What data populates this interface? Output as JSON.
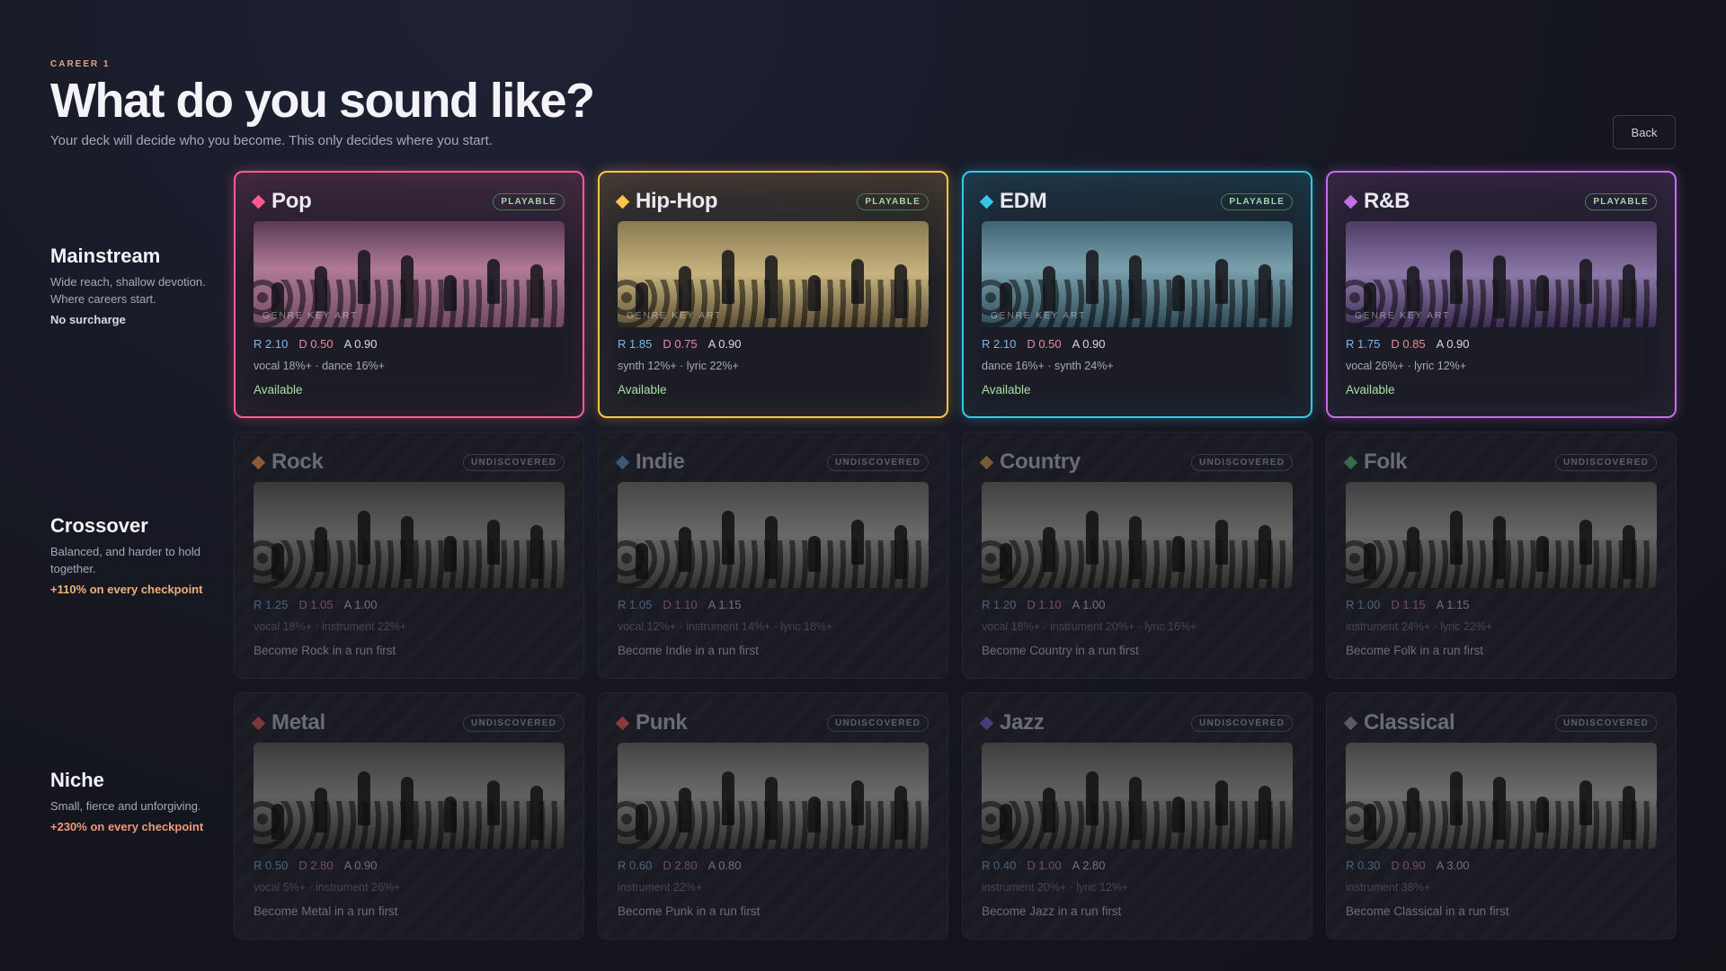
{
  "header": {
    "eyebrow": "CAREER 1",
    "title": "What do you sound like?",
    "subtitle": "Your deck will decide who you become. This only decides where you start.",
    "back_label": "Back"
  },
  "tiers": [
    {
      "name": "Mainstream",
      "desc": "Wide reach, shallow devotion. Where careers start.",
      "cost": "No surcharge",
      "cost_color": "#d8d9e2"
    },
    {
      "name": "Crossover",
      "desc": "Balanced, and harder to hold together.",
      "cost": "+110% on every checkpoint",
      "cost_color": "#f0b07a"
    },
    {
      "name": "Niche",
      "desc": "Small, fierce and unforgiving.",
      "cost": "+230% on every checkpoint",
      "cost_color": "#f09a7a"
    }
  ],
  "colors": {
    "r_stat": "#7fb8e8",
    "d_stat": "#e88a9a",
    "a_stat": "#d8d9e2",
    "available": "#a8e0a0"
  },
  "cards": [
    {
      "title": "Pop",
      "badge": "PLAYABLE",
      "locked": false,
      "accent": "#ff5c93",
      "art_label": "GENRE KEY ART",
      "r": "R 2.10",
      "d": "D 0.50",
      "a": "A 0.90",
      "traits": "vocal 18%+ · dance 16%+",
      "status": "Available",
      "art_bg": "linear-gradient(180deg,#5a3a55 0%,#b07a96 45%,#6e4b62 100%)"
    },
    {
      "title": "Hip-Hop",
      "badge": "PLAYABLE",
      "locked": false,
      "accent": "#ffc54a",
      "art_label": "GENRE KEY ART",
      "r": "R 1.85",
      "d": "D 0.75",
      "a": "A 0.90",
      "traits": "synth 12%+ · lyric 22%+",
      "status": "Available",
      "art_bg": "linear-gradient(180deg,#8a7a52 0%,#c7b37e 50%,#5d5038 100%)"
    },
    {
      "title": "EDM",
      "badge": "PLAYABLE",
      "locked": false,
      "accent": "#35c8e8",
      "art_label": "GENRE KEY ART",
      "r": "R 2.10",
      "d": "D 0.50",
      "a": "A 0.90",
      "traits": "dance 16%+ · synth 24%+",
      "status": "Available",
      "art_bg": "linear-gradient(180deg,#3f6474 0%,#7aa0ae 45%,#2f4a56 100%)"
    },
    {
      "title": "R&B",
      "badge": "PLAYABLE",
      "locked": false,
      "accent": "#c46ee8",
      "art_label": "GENRE KEY ART",
      "r": "R 1.75",
      "d": "D 0.85",
      "a": "A 0.90",
      "traits": "vocal 26%+ · lyric 12%+",
      "status": "Available",
      "art_bg": "linear-gradient(180deg,#4e3c66 0%,#8c78a8 50%,#3c2e52 100%)"
    },
    {
      "title": "Rock",
      "badge": "UNDISCOVERED",
      "locked": true,
      "accent": "#8a5a3a",
      "art_label": "",
      "r": "R 1.25",
      "d": "D 1.05",
      "a": "A 1.00",
      "traits": "vocal 18%+ · instrument 22%+",
      "status": "Become Rock in a run first",
      "art_bg": "linear-gradient(180deg,#4a4c5a 0%,#7c7e8c 50%,#3a3b46 100%)"
    },
    {
      "title": "Indie",
      "badge": "UNDISCOVERED",
      "locked": true,
      "accent": "#3a5a7a",
      "art_label": "",
      "r": "R 1.05",
      "d": "D 1.10",
      "a": "A 1.15",
      "traits": "vocal 12%+ · instrument 14%+ · lyric 18%+",
      "status": "Become Indie in a run first",
      "art_bg": "linear-gradient(180deg,#5a5c68 0%,#8a8c98 50%,#40414c 100%)"
    },
    {
      "title": "Country",
      "badge": "UNDISCOVERED",
      "locked": true,
      "accent": "#7a5a3a",
      "art_label": "",
      "r": "R 1.20",
      "d": "D 1.10",
      "a": "A 1.00",
      "traits": "vocal 18%+ · instrument 20%+ · lyric 16%+",
      "status": "Become Country in a run first",
      "art_bg": "linear-gradient(180deg,#5c5650 0%,#8e8780 50%,#413c38 100%)"
    },
    {
      "title": "Folk",
      "badge": "UNDISCOVERED",
      "locked": true,
      "accent": "#3a6a4a",
      "art_label": "",
      "r": "R 1.00",
      "d": "D 1.15",
      "a": "A 1.15",
      "traits": "instrument 24%+ · lyric 22%+",
      "status": "Become Folk in a run first",
      "art_bg": "linear-gradient(180deg,#545660 0%,#868894 50%,#3c3d46 100%)"
    },
    {
      "title": "Metal",
      "badge": "UNDISCOVERED",
      "locked": true,
      "accent": "#7a3a3a",
      "art_label": "",
      "r": "R 0.50",
      "d": "D 2.80",
      "a": "A 0.90",
      "traits": "vocal 5%+ · instrument 26%+",
      "status": "Become Metal in a run first",
      "art_bg": "linear-gradient(180deg,#4c4e5a 0%,#7e808c 50%,#383944 100%)"
    },
    {
      "title": "Punk",
      "badge": "UNDISCOVERED",
      "locked": true,
      "accent": "#8a3a3a",
      "art_label": "",
      "r": "R 0.60",
      "d": "D 2.80",
      "a": "A 0.80",
      "traits": "instrument 22%+",
      "status": "Become Punk in a run first",
      "art_bg": "linear-gradient(180deg,#585a66 0%,#8c8e9a 50%,#3e3f4a 100%)"
    },
    {
      "title": "Jazz",
      "badge": "UNDISCOVERED",
      "locked": true,
      "accent": "#4a3a7a",
      "art_label": "",
      "r": "R 0.40",
      "d": "D 1.00",
      "a": "A 2.80",
      "traits": "instrument 20%+ · lyric 12%+",
      "status": "Become Jazz in a run first",
      "art_bg": "linear-gradient(180deg,#50525e 0%,#80828e 50%,#3a3b46 100%)"
    },
    {
      "title": "Classical",
      "badge": "UNDISCOVERED",
      "locked": true,
      "accent": "#5a5a66",
      "art_label": "",
      "r": "R 0.30",
      "d": "D 0.90",
      "a": "A 3.00",
      "traits": "instrument 38%+",
      "status": "Become Classical in a run first",
      "art_bg": "linear-gradient(180deg,#5a5c68 0%,#8e909c 50%,#42434e 100%)"
    }
  ]
}
